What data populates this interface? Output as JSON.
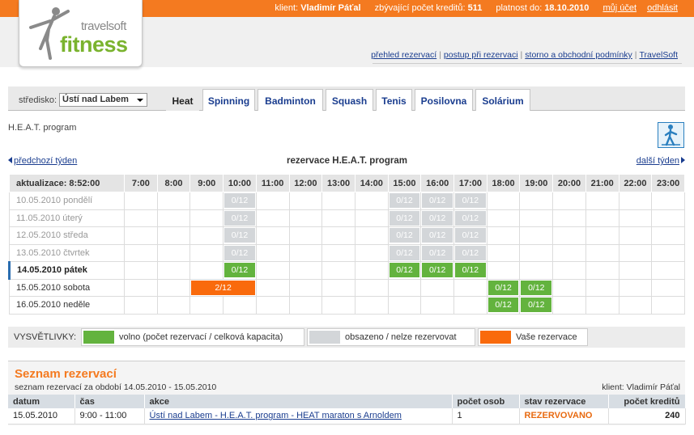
{
  "topbar": {
    "client_label": "klient:",
    "client_name": "Vladimír Páťal",
    "credits_label": "zbývající počet kreditů:",
    "credits_value": "511",
    "valid_label": "platnost do:",
    "valid_value": "18.10.2010",
    "account_link": "můj účet",
    "logout_link": "odhlásit"
  },
  "logo": {
    "brand_small": "travelsoft",
    "brand_large": "fitness"
  },
  "toplinks": [
    "přehled rezervací",
    "postup při rezervaci",
    "storno a obchodní podmínky",
    "TravelSoft"
  ],
  "center": {
    "label": "středisko:",
    "value": "Ústí nad Labem"
  },
  "tabs": [
    "Heat",
    "Spinning",
    "Badminton",
    "Squash",
    "Tenis",
    "Posilovna",
    "Solárium"
  ],
  "program_title": "H.E.A.T. program",
  "nav": {
    "prev": "předchozí týden",
    "title": "rezervace H.E.A.T. program",
    "next": "další týden"
  },
  "grid": {
    "update_label": "aktualizace: 8:52:00",
    "hours": [
      "7:00",
      "8:00",
      "9:00",
      "10:00",
      "11:00",
      "12:00",
      "13:00",
      "14:00",
      "15:00",
      "16:00",
      "17:00",
      "18:00",
      "19:00",
      "20:00",
      "21:00",
      "22:00",
      "23:00"
    ],
    "rows": [
      {
        "day": "10.05.2010 pondělí",
        "state": "past",
        "slots": [
          {
            "hour": "10:00",
            "span": 1,
            "type": "grey",
            "text": "0/12"
          },
          {
            "hour": "15:00",
            "span": 1,
            "type": "grey",
            "text": "0/12"
          },
          {
            "hour": "16:00",
            "span": 1,
            "type": "grey",
            "text": "0/12"
          },
          {
            "hour": "17:00",
            "span": 1,
            "type": "grey",
            "text": "0/12"
          }
        ]
      },
      {
        "day": "11.05.2010 úterý",
        "state": "past",
        "slots": [
          {
            "hour": "10:00",
            "span": 1,
            "type": "grey",
            "text": "0/12"
          },
          {
            "hour": "15:00",
            "span": 1,
            "type": "grey",
            "text": "0/12"
          },
          {
            "hour": "16:00",
            "span": 1,
            "type": "grey",
            "text": "0/12"
          },
          {
            "hour": "17:00",
            "span": 1,
            "type": "grey",
            "text": "0/12"
          }
        ]
      },
      {
        "day": "12.05.2010 středa",
        "state": "past",
        "slots": [
          {
            "hour": "10:00",
            "span": 1,
            "type": "grey",
            "text": "0/12"
          },
          {
            "hour": "15:00",
            "span": 1,
            "type": "grey",
            "text": "0/12"
          },
          {
            "hour": "16:00",
            "span": 1,
            "type": "grey",
            "text": "0/12"
          },
          {
            "hour": "17:00",
            "span": 1,
            "type": "grey",
            "text": "0/12"
          }
        ]
      },
      {
        "day": "13.05.2010 čtvrtek",
        "state": "past",
        "slots": [
          {
            "hour": "10:00",
            "span": 1,
            "type": "grey",
            "text": "0/12"
          },
          {
            "hour": "15:00",
            "span": 1,
            "type": "grey",
            "text": "0/12"
          },
          {
            "hour": "16:00",
            "span": 1,
            "type": "grey",
            "text": "0/12"
          },
          {
            "hour": "17:00",
            "span": 1,
            "type": "grey",
            "text": "0/12"
          }
        ]
      },
      {
        "day": "14.05.2010 pátek",
        "state": "current",
        "slots": [
          {
            "hour": "10:00",
            "span": 1,
            "type": "green",
            "text": "0/12"
          },
          {
            "hour": "15:00",
            "span": 1,
            "type": "green",
            "text": "0/12"
          },
          {
            "hour": "16:00",
            "span": 1,
            "type": "green",
            "text": "0/12"
          },
          {
            "hour": "17:00",
            "span": 1,
            "type": "green",
            "text": "0/12"
          }
        ]
      },
      {
        "day": "15.05.2010 sobota",
        "state": "normal",
        "slots": [
          {
            "hour": "9:00",
            "span": 2,
            "type": "orange",
            "text": "2/12"
          },
          {
            "hour": "18:00",
            "span": 1,
            "type": "green",
            "text": "0/12"
          },
          {
            "hour": "19:00",
            "span": 1,
            "type": "green",
            "text": "0/12"
          }
        ]
      },
      {
        "day": "16.05.2010 neděle",
        "state": "normal",
        "slots": [
          {
            "hour": "18:00",
            "span": 1,
            "type": "green",
            "text": "0/12"
          },
          {
            "hour": "19:00",
            "span": 1,
            "type": "green",
            "text": "0/12"
          }
        ]
      }
    ]
  },
  "legend": {
    "label": "VYSVĚTLIVKY:",
    "items": [
      {
        "color": "#63b33e",
        "text": "volno (počet rezervací / celková kapacita)"
      },
      {
        "color": "#d3d6d9",
        "text": "obsazeno / nelze rezervovat"
      },
      {
        "color": "#f96a0c",
        "text": "Vaše rezervace"
      }
    ]
  },
  "reservations": {
    "title": "Seznam rezervací",
    "subtitle": "seznam rezervací za období 14.05.2010 - 15.05.2010",
    "client": "klient: Vladimír Páťal",
    "columns": [
      "datum",
      "čas",
      "akce",
      "počet osob",
      "stav rezervace",
      "počet kreditů"
    ],
    "rows": [
      {
        "datum": "15.05.2010",
        "cas": "9:00 - 11:00",
        "akce": "Ústí nad Labem - H.E.A.T. program - HEAT maraton s Arnoldem",
        "osob": "1",
        "stav": "REZERVOVANO",
        "kredity": "240"
      }
    ]
  }
}
